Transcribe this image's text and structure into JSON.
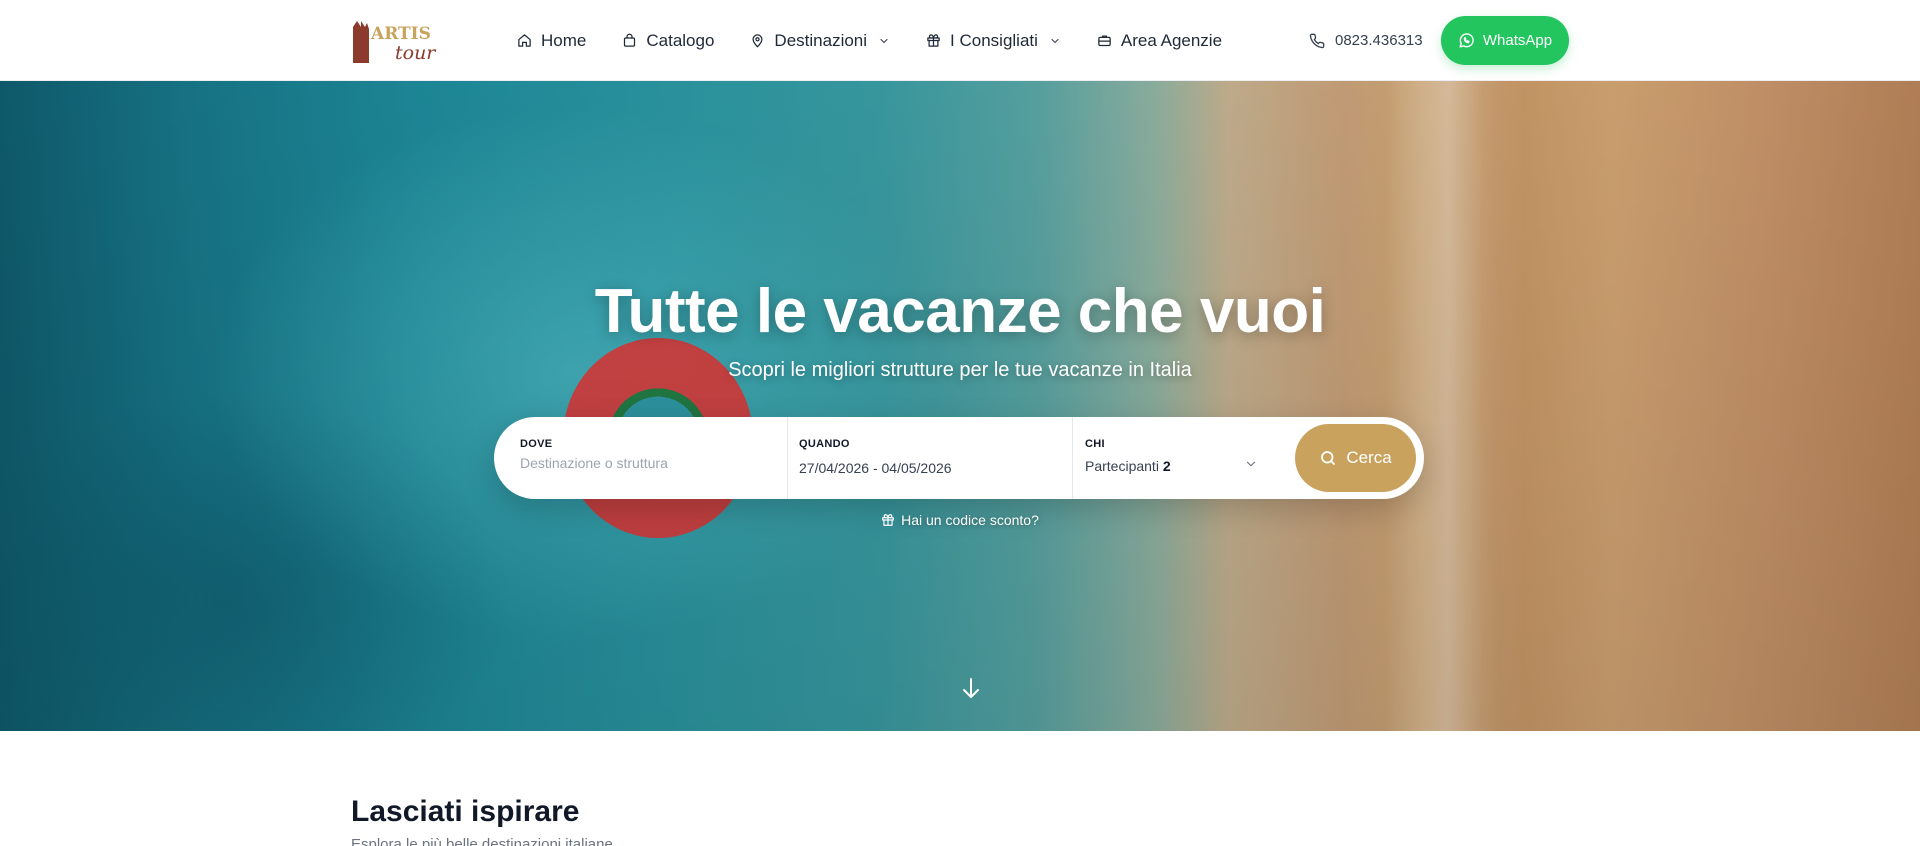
{
  "header": {
    "logo_text": "ARTIS tour",
    "nav": [
      {
        "label": "Home",
        "icon": "home-icon",
        "dropdown": false
      },
      {
        "label": "Catalogo",
        "icon": "bag-icon",
        "dropdown": false
      },
      {
        "label": "Destinazioni",
        "icon": "map-pin-icon",
        "dropdown": true
      },
      {
        "label": "I Consigliati",
        "icon": "gift-icon",
        "dropdown": true
      },
      {
        "label": "Area Agenzie",
        "icon": "briefcase-icon",
        "dropdown": false
      }
    ],
    "phone": "0823.436313",
    "whatsapp_label": "WhatsApp"
  },
  "hero": {
    "title": "Tutte le vacanze che vuoi",
    "subtitle": "Scopri le migliori strutture per le tue vacanze in Italia"
  },
  "search": {
    "dove_label": "DOVE",
    "dove_placeholder": "Destinazione o struttura",
    "quando_label": "QUANDO",
    "quando_value": "27/04/2026 - 04/05/2026",
    "chi_label": "CHI",
    "chi_text": "Partecipanti",
    "chi_count": "2",
    "submit_label": "Cerca"
  },
  "coupon_text": "Hai un codice sconto?",
  "section": {
    "title": "Lasciati ispirare",
    "subtitle": "Esplora le più belle destinazioni italiane"
  },
  "colors": {
    "accent_gold": "#c9a35e",
    "whatsapp_green": "#22c55e",
    "logo_brown": "#8b3a2b"
  }
}
